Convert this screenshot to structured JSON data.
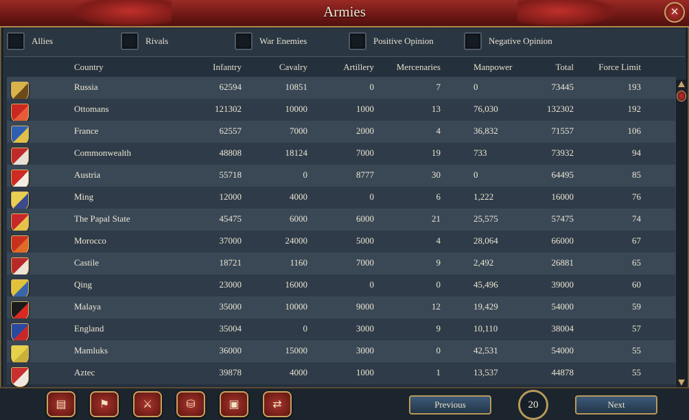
{
  "window": {
    "title": "Armies",
    "close_label": "✕"
  },
  "filters": [
    {
      "label": "Allies",
      "checked": false
    },
    {
      "label": "Rivals",
      "checked": false
    },
    {
      "label": "War Enemies",
      "checked": false
    },
    {
      "label": "Positive Opinion",
      "checked": false
    },
    {
      "label": "Negative Opinion",
      "checked": false
    }
  ],
  "columns": {
    "country": "Country",
    "infantry": "Infantry",
    "cavalry": "Cavalry",
    "artillery": "Artillery",
    "mercenaries": "Mercenaries",
    "manpower": "Manpower",
    "total": "Total",
    "force_limit": "Force Limit"
  },
  "rows": [
    {
      "country": "Russia",
      "infantry": "62594",
      "cavalry": "10851",
      "artillery": "0",
      "mercenaries": "7",
      "manpower": "0",
      "total": "73445",
      "force_limit": "193",
      "flag": [
        "#d8b24a",
        "#6d4a1a"
      ]
    },
    {
      "country": "Ottomans",
      "infantry": "121302",
      "cavalry": "10000",
      "artillery": "1000",
      "mercenaries": "13",
      "manpower": "76,030",
      "total": "132302",
      "force_limit": "192",
      "flag": [
        "#c8281f",
        "#e85a3a"
      ]
    },
    {
      "country": "France",
      "infantry": "62557",
      "cavalry": "7000",
      "artillery": "2000",
      "mercenaries": "4",
      "manpower": "36,832",
      "total": "71557",
      "force_limit": "106",
      "flag": [
        "#2f5fb0",
        "#e0c04a"
      ]
    },
    {
      "country": "Commonwealth",
      "infantry": "48808",
      "cavalry": "18124",
      "artillery": "7000",
      "mercenaries": "19",
      "manpower": "733",
      "total": "73932",
      "force_limit": "94",
      "flag": [
        "#c02a2a",
        "#e8e0d6"
      ]
    },
    {
      "country": "Austria",
      "infantry": "55718",
      "cavalry": "0",
      "artillery": "8777",
      "mercenaries": "30",
      "manpower": "0",
      "total": "64495",
      "force_limit": "85",
      "flag": [
        "#d02a24",
        "#f2ece2"
      ]
    },
    {
      "country": "Ming",
      "infantry": "12000",
      "cavalry": "4000",
      "artillery": "0",
      "mercenaries": "6",
      "manpower": "1,222",
      "total": "16000",
      "force_limit": "76",
      "flag": [
        "#e8cf52",
        "#3a4a8a"
      ]
    },
    {
      "country": "The Papal State",
      "infantry": "45475",
      "cavalry": "6000",
      "artillery": "6000",
      "mercenaries": "21",
      "manpower": "25,575",
      "total": "57475",
      "force_limit": "74",
      "flag": [
        "#c8282a",
        "#e6c24a"
      ]
    },
    {
      "country": "Morocco",
      "infantry": "37000",
      "cavalry": "24000",
      "artillery": "5000",
      "mercenaries": "4",
      "manpower": "28,064",
      "total": "66000",
      "force_limit": "67",
      "flag": [
        "#c8301e",
        "#e06a28"
      ]
    },
    {
      "country": "Castile",
      "infantry": "18721",
      "cavalry": "1160",
      "artillery": "7000",
      "mercenaries": "9",
      "manpower": "2,492",
      "total": "26881",
      "force_limit": "65",
      "flag": [
        "#b82a2a",
        "#ece2d6"
      ]
    },
    {
      "country": "Qing",
      "infantry": "23000",
      "cavalry": "16000",
      "artillery": "0",
      "mercenaries": "0",
      "manpower": "45,496",
      "total": "39000",
      "force_limit": "60",
      "flag": [
        "#e2c23a",
        "#3a66a8"
      ]
    },
    {
      "country": "Malaya",
      "infantry": "35000",
      "cavalry": "10000",
      "artillery": "9000",
      "mercenaries": "12",
      "manpower": "19,429",
      "total": "54000",
      "force_limit": "59",
      "flag": [
        "#1a1a1a",
        "#d82a22"
      ]
    },
    {
      "country": "England",
      "infantry": "35004",
      "cavalry": "0",
      "artillery": "3000",
      "mercenaries": "9",
      "manpower": "10,110",
      "total": "38004",
      "force_limit": "57",
      "flag": [
        "#2a4aa0",
        "#c8282a"
      ]
    },
    {
      "country": "Mamluks",
      "infantry": "36000",
      "cavalry": "15000",
      "artillery": "3000",
      "mercenaries": "0",
      "manpower": "42,531",
      "total": "54000",
      "force_limit": "55",
      "flag": [
        "#e6d24a",
        "#c8b03a"
      ]
    },
    {
      "country": "Aztec",
      "infantry": "39878",
      "cavalry": "4000",
      "artillery": "1000",
      "mercenaries": "1",
      "manpower": "13,537",
      "total": "44878",
      "force_limit": "55",
      "flag": [
        "#c83030",
        "#f0e8e0"
      ]
    }
  ],
  "bottom_icons": [
    {
      "name": "ledger-icon",
      "glyph": "▤"
    },
    {
      "name": "flag-icon",
      "glyph": "⚑"
    },
    {
      "name": "crossed-swords-icon",
      "glyph": "⚔"
    },
    {
      "name": "coins-icon",
      "glyph": "⛁"
    },
    {
      "name": "crate-icon",
      "glyph": "▣"
    },
    {
      "name": "handshake-icon",
      "glyph": "⇄"
    }
  ],
  "pagination": {
    "previous_label": "Previous",
    "page": "20",
    "next_label": "Next"
  }
}
